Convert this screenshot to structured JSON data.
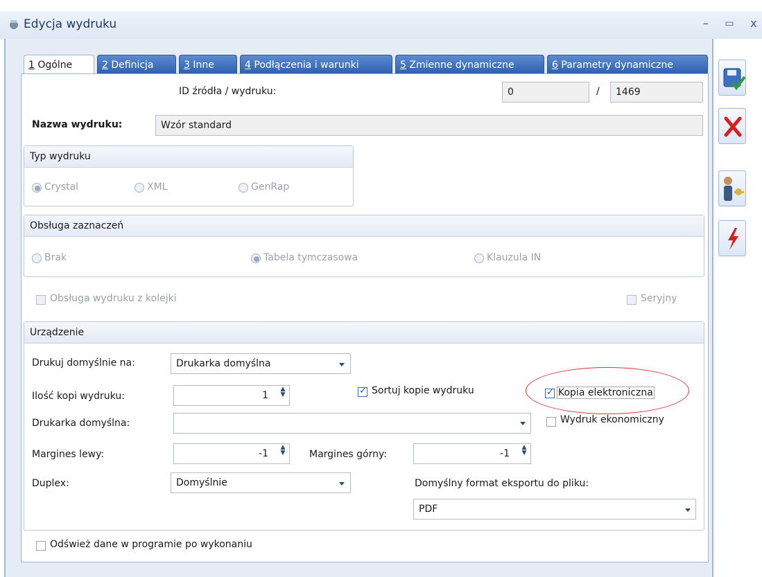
{
  "window": {
    "title": "Edycja wydruku",
    "minimize": "–",
    "maximize": "▭",
    "close": "x"
  },
  "tabs": [
    {
      "num": "1",
      "label": "Ogólne",
      "active": true
    },
    {
      "num": "2",
      "label": "Definicja"
    },
    {
      "num": "3",
      "label": "Inne"
    },
    {
      "num": "4",
      "label": "Podłączenia i warunki"
    },
    {
      "num": "5",
      "label": "Zmienne dynamiczne"
    },
    {
      "num": "6",
      "label": "Parametry dynamiczne"
    }
  ],
  "general": {
    "id_label": "ID źródła / wydruku:",
    "id_source": "0",
    "id_sep": "/",
    "id_print": "1469",
    "name_label": "Nazwa wydruku:",
    "name_value": "Wzór standard"
  },
  "print_type": {
    "header": "Typ wydruku",
    "options": [
      "Crystal",
      "XML",
      "GenRap"
    ],
    "selected": "Crystal"
  },
  "selection_handling": {
    "header": "Obsługa zaznaczeń",
    "options": [
      "Brak",
      "Tabela tymczasowa",
      "Klauzula IN"
    ],
    "selected": "Tabela tymczasowa"
  },
  "queue_checkbox": "Obsługa wydruku z kolejki",
  "serial_checkbox": "Seryjny",
  "device": {
    "header": "Urządzenie",
    "print_default_label": "Drukuj domyślnie na:",
    "print_default_value": "Drukarka domyślna",
    "copies_label": "Ilość kopi wydruku:",
    "copies_value": "1",
    "sort_copies_label": "Sortuj kopie wydruku",
    "electronic_copy_label": "Kopia elektroniczna",
    "default_printer_label": "Drukarka domyślna:",
    "default_printer_value": "",
    "economic_label": "Wydruk ekonomiczny",
    "margin_left_label": "Margines lewy:",
    "margin_left_value": "-1",
    "margin_top_label": "Margines górny:",
    "margin_top_value": "-1",
    "duplex_label": "Duplex:",
    "duplex_value": "Domyślnie",
    "export_format_label": "Domyślny format eksportu do pliku:",
    "export_format_value": "PDF"
  },
  "refresh_checkbox": "Odśwież dane w programie po wykonaniu",
  "colors": {
    "accent": "#2d5fad",
    "highlight_ellipse": "#e03030"
  }
}
